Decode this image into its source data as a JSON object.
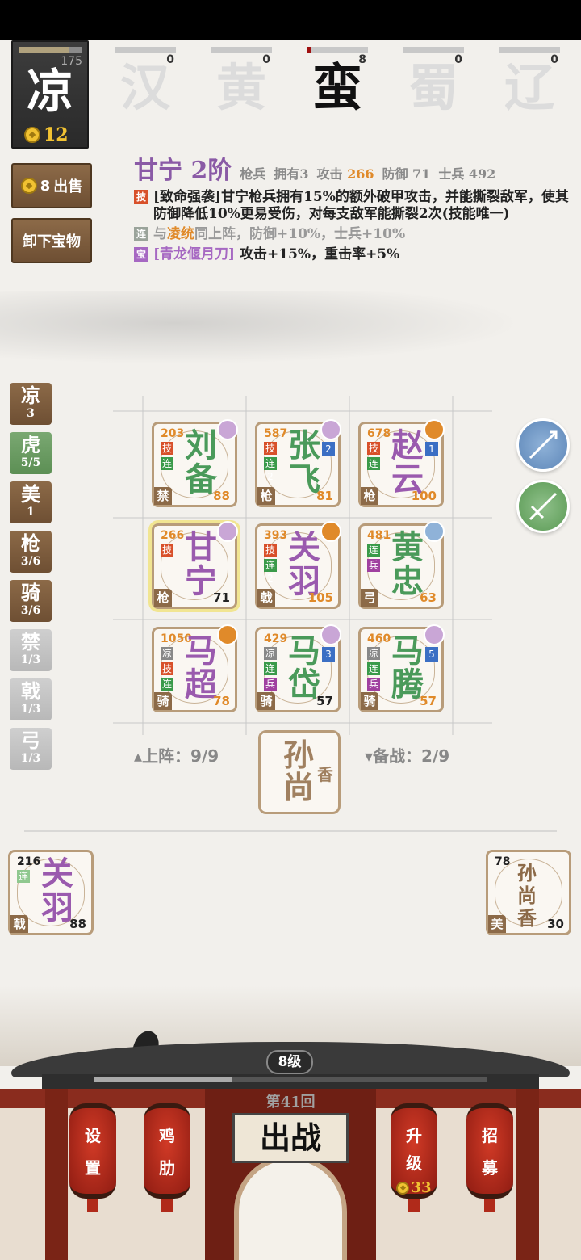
{
  "factions": {
    "current": {
      "name": "凉",
      "progress": 175,
      "gold": 12
    },
    "tabs": [
      {
        "name": "汉",
        "value": "0"
      },
      {
        "name": "黄",
        "value": "0"
      },
      {
        "name": "蛮",
        "value": "8"
      },
      {
        "name": "蜀",
        "value": "0"
      },
      {
        "name": "辽",
        "value": "0"
      }
    ],
    "active_tab": "蛮"
  },
  "buttons": {
    "sell_price": "8",
    "sell_label": "出售",
    "unload_label": "卸下宝物"
  },
  "detail": {
    "name": "甘宁 2阶",
    "type": "枪兵",
    "owned": "拥有3",
    "attack_label": "攻击",
    "attack": "266",
    "defense": "防御 71",
    "soldiers": "士兵 492",
    "skill_tag": "技",
    "skill_text": "[致命强袭]甘宁枪兵拥有15%的额外破甲攻击，并能撕裂敌军，使其防御降低10%更易受伤，对每支敌军能撕裂2次(技能唯一)",
    "link_tag": "连",
    "link_text_pre": "与",
    "link_partner": "凌统",
    "link_text_post": "同上阵，防御+10%，士兵+10%",
    "treasure_tag": "宝",
    "treasure_name": "[青龙偃月刀]",
    "treasure_text": " 攻击+15%，重击率+5%"
  },
  "categories": [
    {
      "c": "凉",
      "n": "3",
      "style": "brown"
    },
    {
      "c": "虎",
      "n": "5/5",
      "style": "green"
    },
    {
      "c": "美",
      "n": "1",
      "style": "brown"
    },
    {
      "c": "枪",
      "n": "3/6",
      "style": "brown"
    },
    {
      "c": "骑",
      "n": "3/6",
      "style": "brown"
    },
    {
      "c": "禁",
      "n": "1/3",
      "style": "grey"
    },
    {
      "c": "戟",
      "n": "1/3",
      "style": "grey"
    },
    {
      "c": "弓",
      "n": "1/3",
      "style": "grey"
    }
  ],
  "board": [
    {
      "name1": "刘",
      "name2": "备",
      "power": "203",
      "tags": [
        "技",
        "连"
      ],
      "type": "禁",
      "def": "88",
      "color": "green"
    },
    {
      "name1": "张",
      "name2": "飞",
      "power": "587",
      "tags": [
        "技",
        "连2"
      ],
      "type": "枪",
      "def": "81",
      "color": "green",
      "star": "2"
    },
    {
      "name1": "赵",
      "name2": "云",
      "power": "678",
      "tags": [
        "技",
        "连"
      ],
      "type": "枪",
      "def": "100",
      "color": "purple",
      "star": "1"
    },
    {
      "name1": "甘",
      "name2": "宁",
      "power": "266",
      "tags": [
        "技"
      ],
      "type": "枪",
      "def": "71",
      "color": "purple",
      "selected": true
    },
    {
      "name1": "关",
      "name2": "羽",
      "power": "393",
      "tags": [
        "技",
        "连2"
      ],
      "type": "戟",
      "def": "105",
      "color": "purple"
    },
    {
      "name1": "黄",
      "name2": "忠",
      "power": "481",
      "tags": [
        "连",
        "兵"
      ],
      "type": "弓",
      "def": "63",
      "color": "green"
    },
    {
      "name1": "马",
      "name2": "超",
      "power": "1050",
      "tags": [
        "凉",
        "技",
        "连2"
      ],
      "type": "骑",
      "def": "78",
      "color": "purple"
    },
    {
      "name1": "马",
      "name2": "岱",
      "power": "429",
      "tags": [
        "凉",
        "连",
        "兵"
      ],
      "type": "骑",
      "def": "57",
      "color": "green",
      "star": "3"
    },
    {
      "name1": "马",
      "name2": "腾",
      "power": "460",
      "tags": [
        "凉",
        "连",
        "兵"
      ],
      "type": "骑",
      "def": "57",
      "color": "green",
      "star": "5"
    }
  ],
  "deploy": {
    "on_field": "▴上阵：9/9",
    "reserve": "▾备战：2/9",
    "featured_name1": "孙",
    "featured_name2": "尚",
    "featured_name3": "香"
  },
  "bench": [
    {
      "name1": "关",
      "name2": "羽",
      "power": "216",
      "tag": "连",
      "type": "戟",
      "def": "88"
    },
    {
      "name1": "孙",
      "name2": "尚",
      "name3": "香",
      "power": "78",
      "type": "美",
      "def": "30"
    }
  ],
  "bottom": {
    "level": "8级",
    "round": "第41回",
    "go": "出战",
    "settings": [
      "设",
      "置"
    ],
    "chicken": [
      "鸡",
      "肋"
    ],
    "upgrade": [
      "升",
      "级"
    ],
    "upgrade_cost": "33",
    "recruit": [
      "招",
      "募"
    ]
  },
  "colors": {
    "accent_orange": "#e08a2a",
    "accent_purple": "#a668c2",
    "brown": "#8c6a48",
    "lantern_red": "#d13a26"
  }
}
